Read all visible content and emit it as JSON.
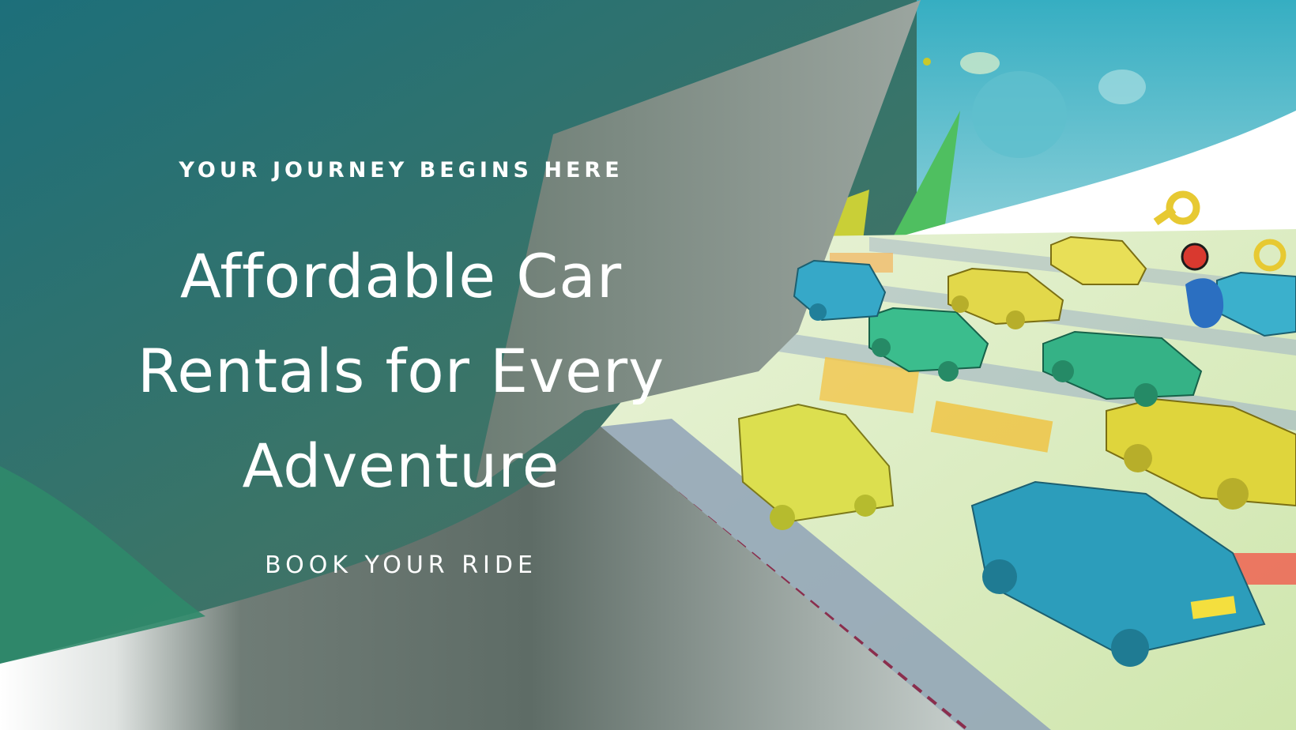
{
  "hero": {
    "eyebrow": "YOUR JOURNEY BEGINS HERE",
    "headline_lines": [
      "Affordable Car",
      "Rentals for Every",
      "Adventure"
    ],
    "cta_label": "BOOK YOUR RIDE"
  },
  "illustration": {
    "subject": "paper-craft cars on a city street map",
    "icons": [
      "car-key-icon",
      "location-pin-icon"
    ]
  },
  "colors": {
    "teal_dark": "#20727a",
    "teal_green": "#2f8a6a",
    "grey_panel": "#6e7f79",
    "sky": "#46b8cb",
    "map_bg": "#d9ecbf",
    "car_yellow": "#dcd947",
    "car_blue": "#2a9fbb",
    "car_green": "#37b187",
    "text": "#ffffff"
  }
}
